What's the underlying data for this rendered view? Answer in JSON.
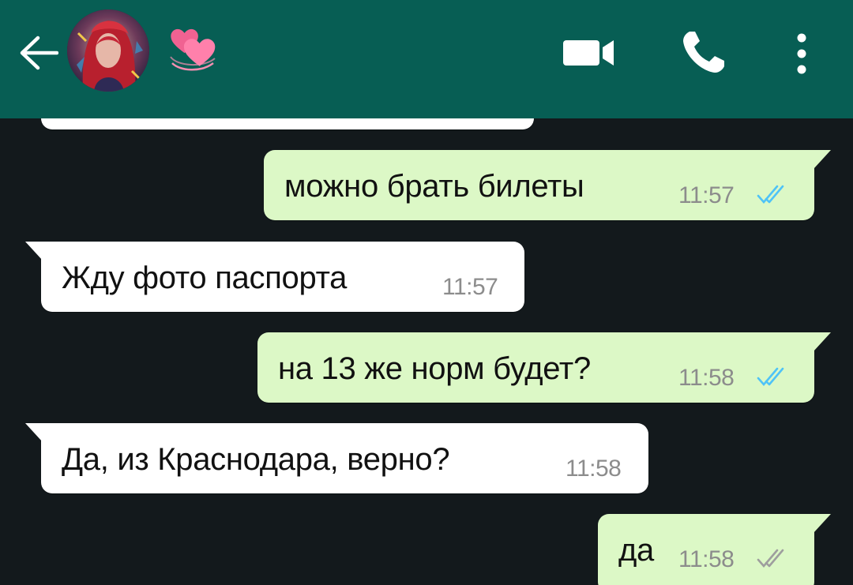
{
  "header": {
    "contact_name_emoji": "💞",
    "icons": [
      "back-arrow-icon",
      "avatar",
      "video-call-icon",
      "phone-icon",
      "more-options-icon"
    ]
  },
  "messages": [
    {
      "direction": "outgoing",
      "text": "можно брать билеты",
      "time": "11:57",
      "status": "read"
    },
    {
      "direction": "incoming",
      "text": "Жду фото паспорта",
      "time": "11:57"
    },
    {
      "direction": "outgoing",
      "text": "на 13 же норм будет?",
      "time": "11:58",
      "status": "read"
    },
    {
      "direction": "incoming",
      "text": "Да, из Краснодара, верно?",
      "time": "11:58"
    },
    {
      "direction": "outgoing",
      "text": "да",
      "time": "11:58",
      "status": "delivered"
    }
  ],
  "colors": {
    "header": "#075e54",
    "background": "#13191c",
    "outgoing_bubble": "#dcf8c6",
    "incoming_bubble": "#ffffff",
    "read_ticks": "#4fc3f7",
    "delivered_ticks": "#9e9e9e"
  }
}
